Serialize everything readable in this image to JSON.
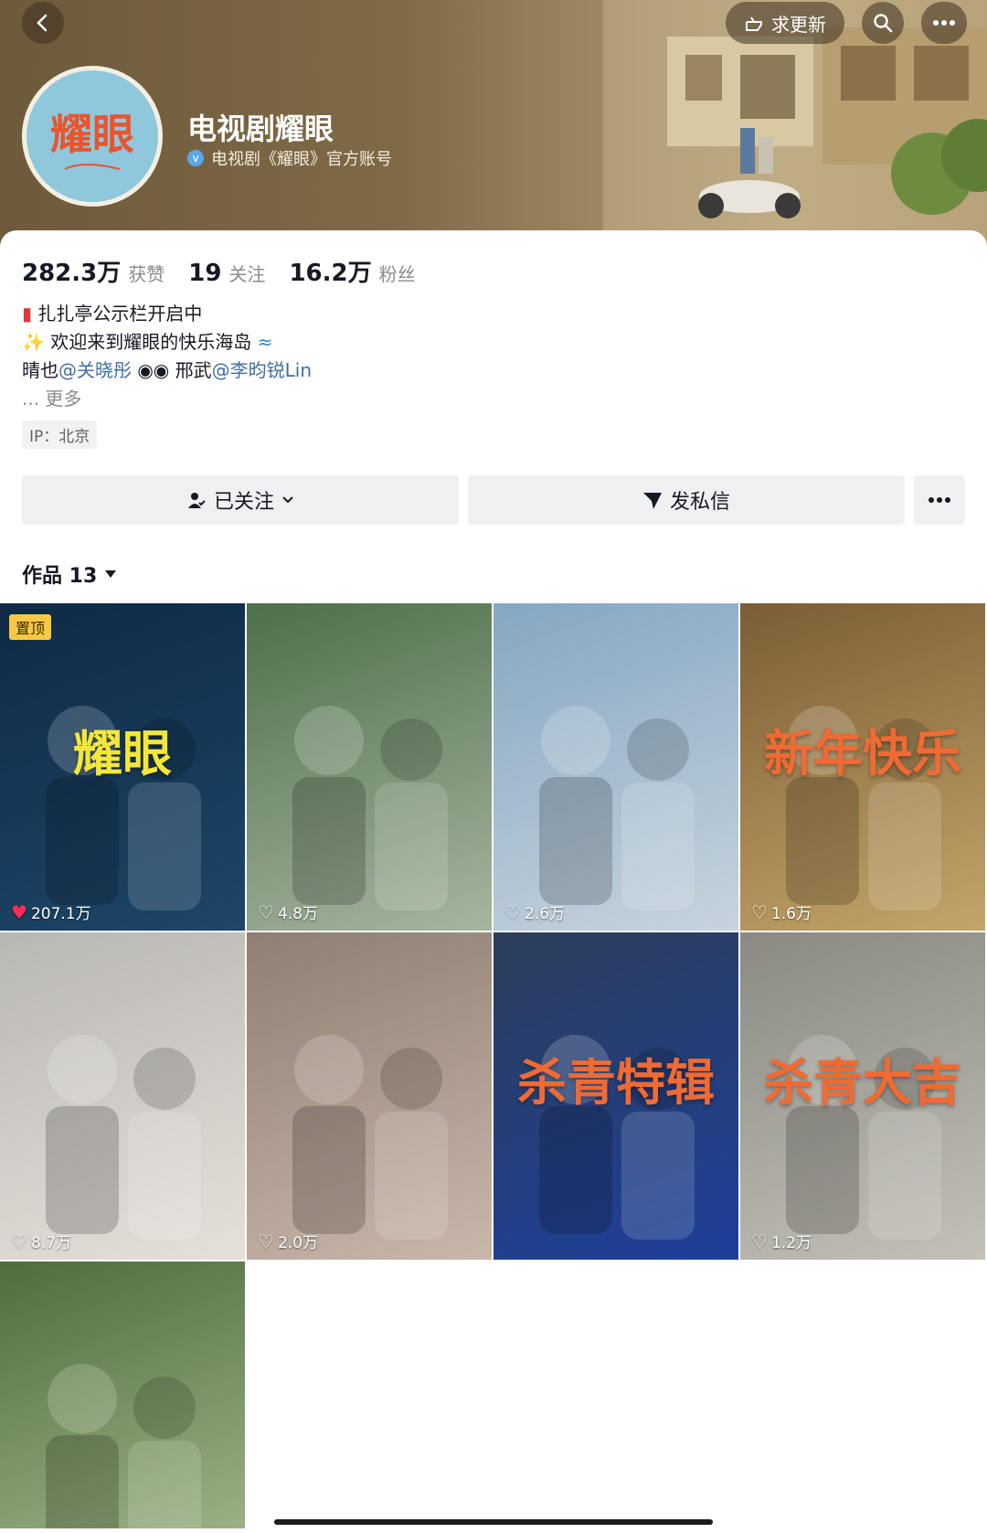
{
  "header": {
    "request_update_label": "求更新",
    "account_name": "电视剧耀眼",
    "verification": "电视剧《耀眼》官方账号",
    "avatar_logo": "耀眼"
  },
  "stats": {
    "likes_num": "282.3万",
    "likes_label": "获赞",
    "following_num": "19",
    "following_label": "关注",
    "fans_num": "16.2万",
    "fans_label": "粉丝"
  },
  "bio": {
    "line1": "扎扎亭公示栏开启中",
    "line2": "欢迎来到耀眼的快乐海岛",
    "line3_a": "晴也",
    "line3_mention1": "@关晓彤",
    "line3_b": "邢武",
    "line3_mention2": "@李昀锐Lin",
    "more": "... 更多"
  },
  "ip_tag": "IP：北京",
  "actions": {
    "follow_label": "已关注",
    "message_label": "发私信"
  },
  "works_tab": {
    "label": "作品 13"
  },
  "videos": [
    {
      "likes": "207.1万",
      "pinned_label": "置顶",
      "liked": true,
      "colors": [
        "#0f2a45",
        "#1d4668"
      ],
      "overlay_text": "耀眼"
    },
    {
      "likes": "4.8万",
      "colors": [
        "#4d6f4a",
        "#a7b5a0"
      ]
    },
    {
      "likes": "2.6万",
      "colors": [
        "#85a7c2",
        "#c7d3dd"
      ]
    },
    {
      "likes": "1.6万",
      "colors": [
        "#7b5d35",
        "#c4a56a"
      ],
      "overlay_text": "新年快乐"
    },
    {
      "likes": "8.7万",
      "colors": [
        "#b9b7b3",
        "#e5e0d9"
      ]
    },
    {
      "likes": "2.0万",
      "colors": [
        "#8f7e72",
        "#c9b7ab"
      ]
    },
    {
      "likes": "",
      "colors": [
        "#2c3e5a",
        "#1d3f9a"
      ],
      "overlay_text": "杀青特辑"
    },
    {
      "likes": "1.2万",
      "colors": [
        "#8a8a82",
        "#c3c0b7"
      ],
      "overlay_text": "杀青大吉"
    },
    {
      "likes": "",
      "colors": [
        "#4f6d3c",
        "#9ab184"
      ]
    }
  ]
}
